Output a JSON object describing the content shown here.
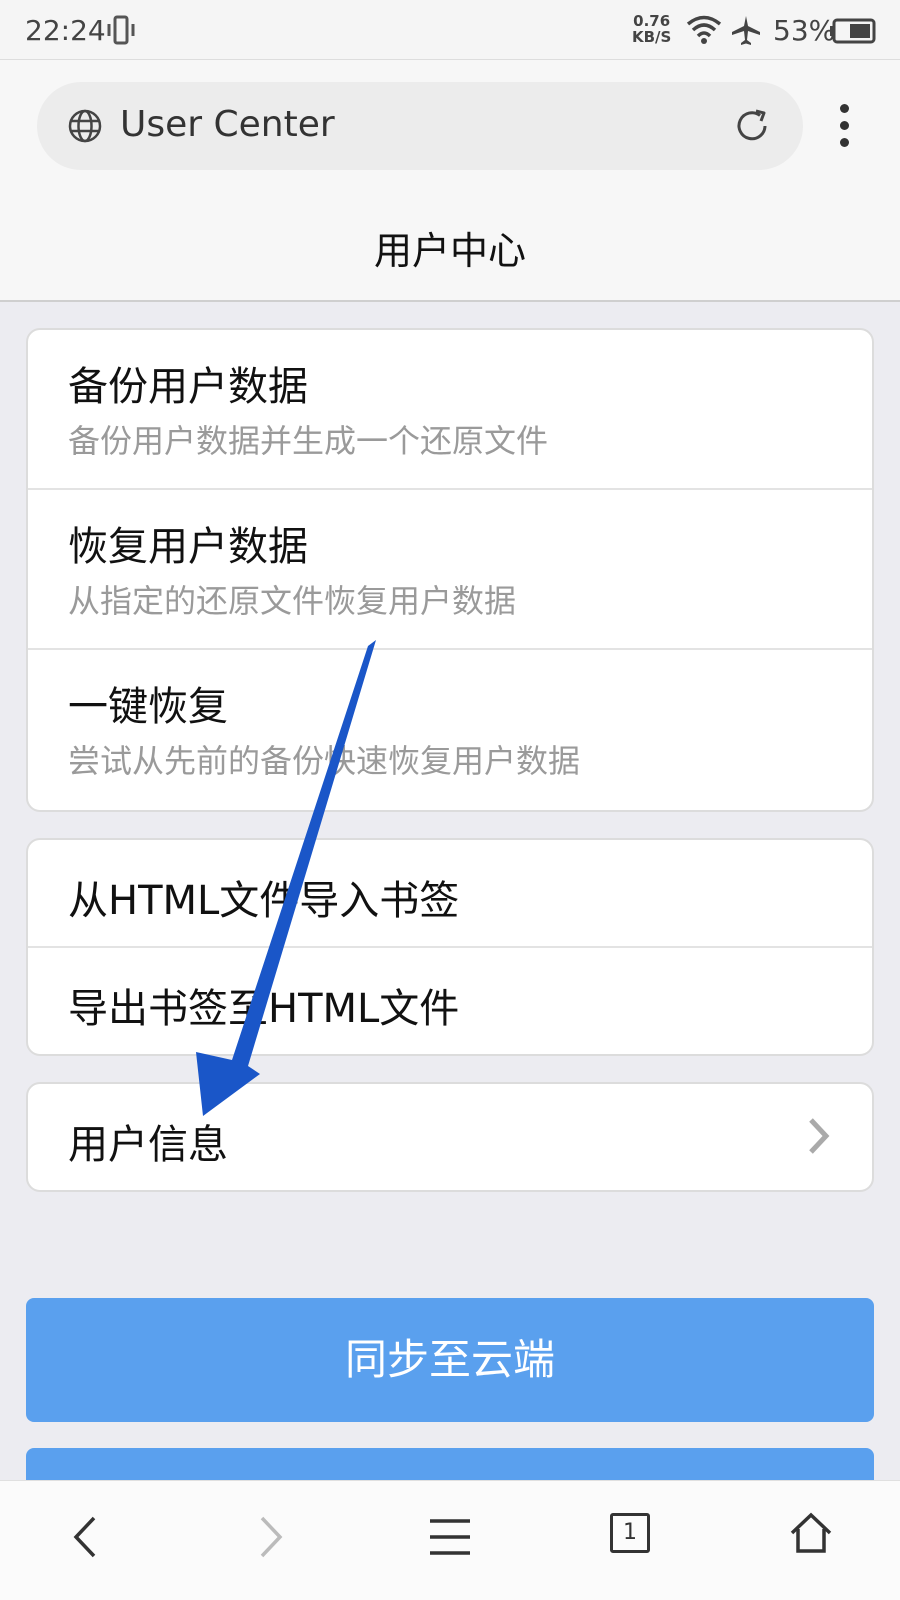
{
  "status_bar": {
    "time": "22:24",
    "speed_value": "0.76",
    "speed_unit": "KB/S",
    "battery": "53%"
  },
  "browser": {
    "url": "User Center",
    "page_title": "用户中心"
  },
  "backup_card": {
    "items": [
      {
        "title": "备份用户数据",
        "subtitle": "备份用户数据并生成一个还原文件"
      },
      {
        "title": "恢复用户数据",
        "subtitle": "从指定的还原文件恢复用户数据"
      },
      {
        "title": "一键恢复",
        "subtitle": "尝试从先前的备份快速恢复用户数据"
      }
    ]
  },
  "bookmark_card": {
    "items": [
      {
        "title": "从HTML文件导入书签"
      },
      {
        "title": "导出书签至HTML文件"
      }
    ]
  },
  "user_card": {
    "title": "用户信息"
  },
  "sync_button": "同步至云端",
  "bottom_nav": {
    "tab_count": "1"
  },
  "colors": {
    "accent_button": "#5aa0ee",
    "annotation_arrow": "#1a56c8"
  },
  "icons": [
    "vibrate-icon",
    "wifi-icon",
    "airplane-icon",
    "battery-icon",
    "globe-icon",
    "reload-icon",
    "more-icon",
    "chevron-right-icon",
    "back-icon",
    "forward-icon",
    "menu-icon",
    "tabs-icon",
    "home-icon"
  ]
}
